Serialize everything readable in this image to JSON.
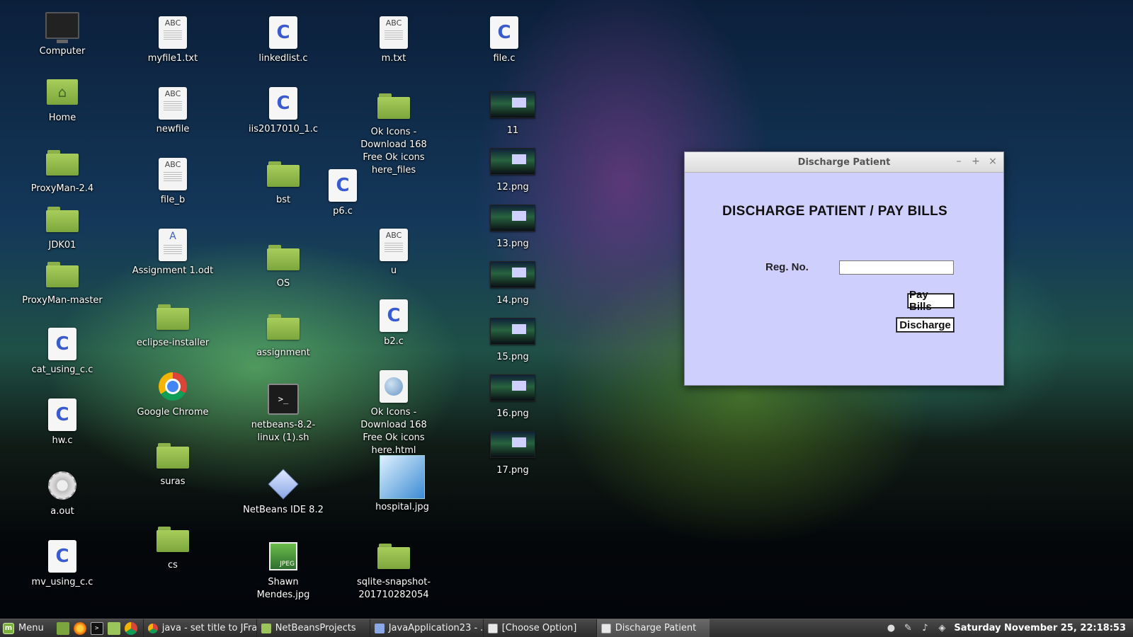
{
  "desktop": {
    "icons": {
      "computer": "Computer",
      "home": "Home",
      "proxyman24": "ProxyMan-2.4",
      "jdk01": "JDK01",
      "proxyman_master": "ProxyMan-master",
      "cat_using_c": "cat_using_c.c",
      "hw_c": "hw.c",
      "a_out": "a.out",
      "mv_using_c": "mv_using_c.c",
      "myfile1": "myfile1.txt",
      "newfile": "newfile",
      "file_b": "file_b",
      "assignment1": "Assignment 1.odt",
      "eclipse_installer": "eclipse-installer",
      "google_chrome": "Google Chrome",
      "suras": "suras",
      "cs": "cs",
      "linkedlist": "linkedlist.c",
      "iis": "iis2017010_1.c",
      "bst": "bst",
      "os": "OS",
      "assignment": "assignment",
      "netbeans_sh": "netbeans-8.2-linux (1).sh",
      "netbeans_ide": "NetBeans IDE 8.2",
      "shawn": "Shawn Mendes.jpg",
      "p6": "p6.c",
      "m_txt": "m.txt",
      "ok_files": "Ok Icons - Download 168 Free Ok icons here_files",
      "u": "u",
      "b2": "b2.c",
      "ok_html": "Ok Icons - Download 168 Free Ok icons here.html",
      "hospital": "hospital.jpg",
      "sqlite": "sqlite-snapshot-201710282054",
      "file_c": "file.c",
      "png11": "11",
      "png12": "12.png",
      "png13": "13.png",
      "png14": "14.png",
      "png15": "15.png",
      "png16": "16.png",
      "png17": "17.png",
      "abc": "ABC",
      "c_letter": "C",
      "jpeg": "JPEG",
      "term_prompt": ">_"
    }
  },
  "window": {
    "title": "Discharge Patient",
    "minimize": "–",
    "maximize": "+",
    "close": "×",
    "heading": "DISCHARGE PATIENT / PAY BILLS",
    "reg_label": "Reg. No.",
    "reg_value": "",
    "pay_bills": "Pay Bills",
    "discharge": "Discharge"
  },
  "taskbar": {
    "menu_label": "Menu",
    "tasks": [
      {
        "label": "java - set title to JFra...",
        "icon": "chrome-icon"
      },
      {
        "label": "NetBeansProjects",
        "icon": "folder-icon"
      },
      {
        "label": "JavaApplication23 - ...",
        "icon": "netbeans-icon"
      },
      {
        "label": "[Choose Option]",
        "icon": "java-icon"
      },
      {
        "label": "Discharge Patient",
        "icon": "java-icon",
        "active": true
      }
    ],
    "clock": "Saturday November 25, 22:18:53"
  }
}
